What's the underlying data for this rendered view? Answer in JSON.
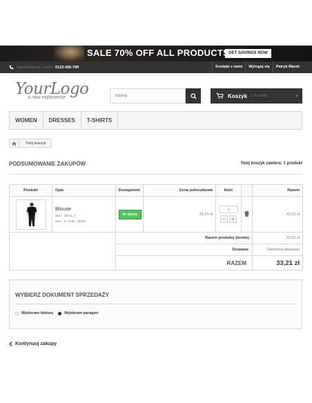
{
  "banner": {
    "text": "SALE 70% OFF ALL PRODUCTS",
    "button": "GET SAVINGS NOW"
  },
  "topbar": {
    "phone_label": "Skontaktuj się z nami",
    "phone_number": "0123-456-789",
    "links": [
      "Kontakt z nami",
      "Wyloguj się",
      "Patryk Marek"
    ]
  },
  "logo": {
    "main": "YourLogo",
    "tagline": "a new experience"
  },
  "search": {
    "placeholder": "Szukaj"
  },
  "cart": {
    "label": "Koszyk",
    "count": "1 Produkt"
  },
  "menu": {
    "items": [
      "Women",
      "Dresses",
      "T-shirts"
    ]
  },
  "breadcrumb": {
    "current": "Twój koszyk"
  },
  "page": {
    "title": "Podsumowanie zakupów",
    "count_text": "Twój koszyk zawiera: 1 produkt"
  },
  "table": {
    "headers": {
      "product": "Produkt",
      "description": "Opis",
      "availability": "Dostępność",
      "unit_price": "Cena jednostkowa",
      "quantity": "Ilość",
      "total": "Razem"
    },
    "row": {
      "name": "Blouse",
      "sku": "SKU : demo_2",
      "attributes": "Size : S, Color : Black",
      "stock": "In stock",
      "unit_price": "33,21 zł",
      "quantity": "1",
      "total": "33,21 zł"
    },
    "summary": {
      "products_label": "Razem produkty (brutto)",
      "products_value": "33,21 zł",
      "shipping_label": "Dostawa:",
      "shipping_value": "Darmowa dostawa!",
      "total_label": "Razem",
      "total_value": "33,21 zł"
    }
  },
  "document": {
    "title": "Wybierz dokument sprzedaży",
    "option_invoice": "Wybieram fakturę",
    "option_receipt": "Wybieram paragon",
    "selected": "Wybieram paragon"
  },
  "continue_label": "Kontynuuj zakupy",
  "colors": {
    "dark": "#333333",
    "in_stock": "#55c65e",
    "border": "#d6d4d4"
  }
}
